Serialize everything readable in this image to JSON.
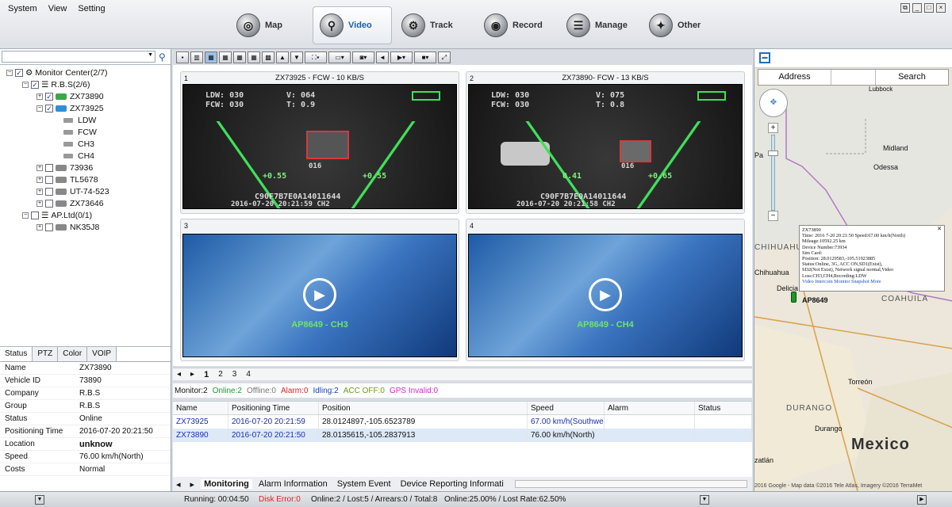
{
  "menu": [
    "System",
    "View",
    "Setting"
  ],
  "nav": [
    {
      "label": "Map",
      "icon": "map-icon"
    },
    {
      "label": "Video",
      "icon": "video-icon"
    },
    {
      "label": "Track",
      "icon": "track-icon"
    },
    {
      "label": "Record",
      "icon": "record-icon"
    },
    {
      "label": "Manage",
      "icon": "manage-icon"
    },
    {
      "label": "Other",
      "icon": "other-icon"
    }
  ],
  "tree": {
    "root": "Monitor Center(2/7)",
    "group1": "R.B.S(2/6)",
    "v1": "ZX73890",
    "v2": "ZX73925",
    "channels": [
      "LDW",
      "FCW",
      "CH3",
      "CH4"
    ],
    "v3": "73936",
    "v4": "TL5678",
    "v5": "UT-74-523",
    "v6": "ZX73646",
    "group2": "AP.Ltd(0/1)",
    "v7": "NK35J8"
  },
  "infotabs": [
    "Status",
    "PTZ",
    "Color",
    "VOIP"
  ],
  "info": [
    [
      "Name",
      "ZX73890"
    ],
    [
      "Vehicle ID",
      "73890"
    ],
    [
      "Company",
      "R.B.S"
    ],
    [
      "Group",
      "R.B.S"
    ],
    [
      "Status",
      "Online"
    ],
    [
      "Positioning Time",
      "2016-07-20 20:21:50"
    ],
    [
      "Location",
      "unknow"
    ],
    [
      "Speed",
      "76.00 km/h(North)"
    ],
    [
      "Costs",
      "Normal"
    ]
  ],
  "video": {
    "p1": {
      "num": "1",
      "title": "ZX73925 - FCW - 10 KB/S",
      "ldw": "LDW: 030",
      "fcw": "FCW: 030",
      "v": "V: 064",
      "t": "T: 0.9",
      "dist": "016",
      "l": "+0.55",
      "r": "+0.55",
      "id": "C90F7B7E0A14011644",
      "ts": "2016-07-20 20:21:59   CH2"
    },
    "p2": {
      "num": "2",
      "title": "ZX73890- FCW - 13 KB/S",
      "ldw": "LDW: 030",
      "fcw": "FCW: 030",
      "v": "V: 075",
      "t": "T: 0.8",
      "dist": "016",
      "l": "0.41",
      "r": "+0.65",
      "id": "C90F7B7E0A14011644",
      "ts": "2016-07-20 20:21:58   CH2"
    },
    "p3": {
      "num": "3",
      "label": "AP8649 - CH3"
    },
    "p4": {
      "num": "4",
      "label": "AP8649 - CH4"
    }
  },
  "pages": [
    "1",
    "2",
    "3",
    "4"
  ],
  "stats": {
    "monitor": "Monitor:2",
    "online": "Online:2",
    "offline": "Offline:0",
    "alarm": "Alarm:0",
    "idling": "Idling:2",
    "acc": "ACC OFF:0",
    "gps": "GPS Invalid:0"
  },
  "table": {
    "headers": [
      "Name",
      "Positioning Time",
      "Position",
      "Speed",
      "Alarm",
      "Status"
    ],
    "rows": [
      [
        "ZX73925",
        "2016-07-20 20:21:59",
        "28.0124897,-105.6523789",
        "67.00 km/h(Southwes",
        "",
        ""
      ],
      [
        "ZX73890",
        "2016-07-20 20:21:50",
        "28.0135615,-105.2837913",
        "76.00 km/h(North)",
        "",
        ""
      ]
    ]
  },
  "bottomtabs": [
    "Monitoring",
    "Alarm Information",
    "System Event",
    "Device Reporting Informati"
  ],
  "map": {
    "address": "Address",
    "search": "Search",
    "popup": [
      "ZX73890",
      "Time: 2016 7-20 20:21:50 Speed:67.00 km/h(North)",
      "Mileage:10592.25 km",
      "Device Number:73934",
      "Sim Card:",
      "Position: 28.0129583,-105.51923885",
      "Status:Online, 3G, ACC ON,SD1(Exist),",
      "SD2(Not Exist), Network signal normal,Video",
      "Loss:CH3,CH4,Recording:LDW",
      "Video  Intercom  Monitor  Snapshot  More"
    ],
    "labels": {
      "lubbock": "Lubbock",
      "midland": "Midland",
      "odessa": "Odessa",
      "chihuahua_state": "CHIHUAHUA",
      "chihuahua": "Chihuahua",
      "delicias": "Delicia",
      "ap": "AP8649",
      "coahuila": "COAHUILA",
      "torreon": "Torreón",
      "durango": "DURANGO",
      "durango_city": "Durango",
      "mexico": "Mexico",
      "pa": "Pa",
      "ciudad": "zatlán",
      "copyright": "2016 Google - Map data ©2016 Tele Atlas, Imagery ©2016 TerraMet"
    }
  },
  "status": {
    "running": "Running: 00:04:50",
    "disk": "Disk Error:0",
    "online": "Online:2 / Lost:5 / Arrears:0 / Total:8",
    "rate": "Online:25.00% / Lost Rate:62.50%"
  }
}
